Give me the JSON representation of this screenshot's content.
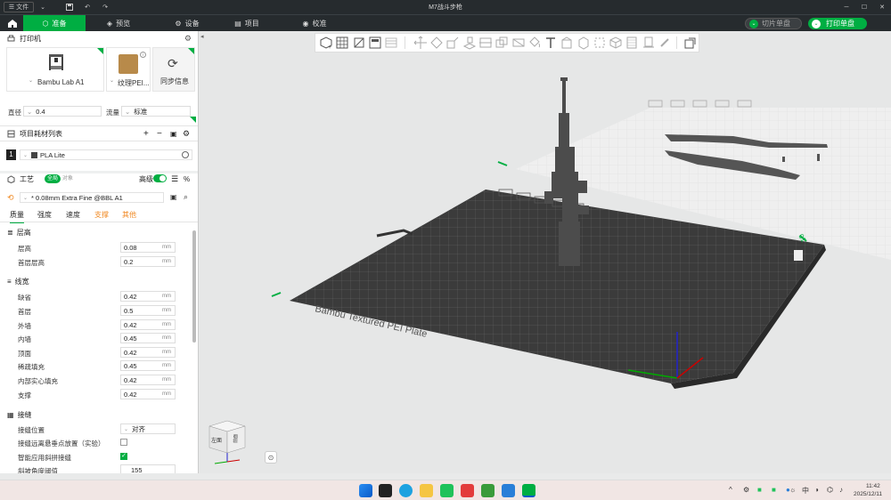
{
  "title_bar": {
    "file_menu": "文件",
    "title": "M7战斗步枪"
  },
  "nav": {
    "tabs": [
      {
        "label": "准备"
      },
      {
        "label": "预览"
      },
      {
        "label": "设备"
      },
      {
        "label": "项目"
      },
      {
        "label": "校准"
      }
    ],
    "slice_button": "切片单盘",
    "print_button": "打印单盘",
    "accent": "#00ae42"
  },
  "printer": {
    "section_title": "打印机",
    "printer_name": "Bambu Lab A1",
    "plate_name": "纹理PEI...",
    "sync_label": "同步信息",
    "nozzle_label": "直径",
    "nozzle_value": "0.4",
    "flow_label": "流量",
    "flow_value": "标准"
  },
  "filament": {
    "section_title": "项目耗材列表",
    "slot_number": "1",
    "name": "PLA Lite"
  },
  "process": {
    "section_title": "工艺",
    "toggle_global": "全局",
    "toggle_object": "对象",
    "advanced_label": "高级",
    "preset": "* 0.08mm Extra Fine @BBL A1",
    "tabs": [
      "质量",
      "强度",
      "速度",
      "支撑",
      "其他"
    ],
    "layer_height": {
      "title": "层高",
      "rows": [
        {
          "label": "层高",
          "value": "0.08",
          "unit": "mm"
        },
        {
          "label": "首层层高",
          "value": "0.2",
          "unit": "mm"
        }
      ]
    },
    "line_width": {
      "title": "线宽",
      "rows": [
        {
          "label": "缺省",
          "value": "0.42",
          "unit": "mm"
        },
        {
          "label": "首层",
          "value": "0.5",
          "unit": "mm"
        },
        {
          "label": "外墙",
          "value": "0.42",
          "unit": "mm"
        },
        {
          "label": "内墙",
          "value": "0.45",
          "unit": "mm"
        },
        {
          "label": "顶面",
          "value": "0.42",
          "unit": "mm"
        },
        {
          "label": "稀疏填充",
          "value": "0.45",
          "unit": "mm"
        },
        {
          "label": "内部实心填充",
          "value": "0.42",
          "unit": "mm"
        },
        {
          "label": "支撑",
          "value": "0.42",
          "unit": "mm"
        }
      ]
    },
    "seam": {
      "title": "接缝",
      "position_label": "接缝位置",
      "position_value": "对齐",
      "overhang_label": "接缝远离悬垂点放置（实验）",
      "scarf_label": "智能应用斜拼接缝",
      "slope_label": "斜坡角度阈值",
      "slope_value": "155"
    }
  },
  "viewport": {
    "plate_label": "Bambu Textured PEI Plate",
    "plate_number": "01",
    "cube_front": "左面",
    "cube_side": "前面"
  },
  "taskbar": {
    "ime": "中",
    "time": "11:42",
    "date": "2025/12/11"
  }
}
